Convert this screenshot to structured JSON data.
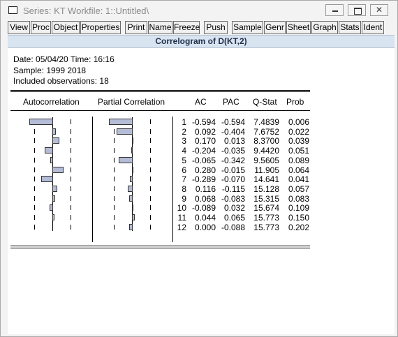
{
  "window": {
    "title": "Series: KT   Workfile: 1::Untitled\\"
  },
  "toolbar": [
    "View",
    "Proc",
    "Object",
    "Properties",
    "Print",
    "Name",
    "Freeze",
    "Push",
    "Sample",
    "Genr",
    "Sheet",
    "Graph",
    "Stats",
    "Ident"
  ],
  "header": {
    "title": "Correlogram of D(KT,2)"
  },
  "info": {
    "date": "Date: 05/04/20   Time: 16:16",
    "sample": "Sample: 1999 2018",
    "obs": "Included observations: 18"
  },
  "columns": {
    "autocorrelation": "Autocorrelation",
    "partial": "Partial Correlation",
    "ac": "AC",
    "pac": "PAC",
    "qstat": "Q-Stat",
    "prob": "Prob"
  },
  "rows": [
    {
      "lag": "1",
      "ac": "-0.594",
      "pac": "-0.594",
      "q": "7.4839",
      "prob": "0.006"
    },
    {
      "lag": "2",
      "ac": "0.092",
      "pac": "-0.404",
      "q": "7.6752",
      "prob": "0.022"
    },
    {
      "lag": "3",
      "ac": "0.170",
      "pac": "0.013",
      "q": "8.3700",
      "prob": "0.039"
    },
    {
      "lag": "4",
      "ac": "-0.204",
      "pac": "-0.035",
      "q": "9.4420",
      "prob": "0.051"
    },
    {
      "lag": "5",
      "ac": "-0.065",
      "pac": "-0.342",
      "q": "9.5605",
      "prob": "0.089"
    },
    {
      "lag": "6",
      "ac": "0.280",
      "pac": "-0.015",
      "q": "11.905",
      "prob": "0.064"
    },
    {
      "lag": "7",
      "ac": "-0.289",
      "pac": "-0.070",
      "q": "14.641",
      "prob": "0.041"
    },
    {
      "lag": "8",
      "ac": "0.116",
      "pac": "-0.115",
      "q": "15.128",
      "prob": "0.057"
    },
    {
      "lag": "9",
      "ac": "0.068",
      "pac": "-0.083",
      "q": "15.315",
      "prob": "0.083"
    },
    {
      "lag": "10",
      "ac": "-0.089",
      "pac": "0.032",
      "q": "15.674",
      "prob": "0.109"
    },
    {
      "lag": "11",
      "ac": "0.044",
      "pac": "0.065",
      "q": "15.773",
      "prob": "0.150"
    },
    {
      "lag": "12",
      "ac": "0.000",
      "pac": "-0.088",
      "q": "15.773",
      "prob": "0.202"
    }
  ],
  "colors": {
    "bar_fill": "#b5bcd7",
    "header_bg": "#d9e4f1"
  }
}
